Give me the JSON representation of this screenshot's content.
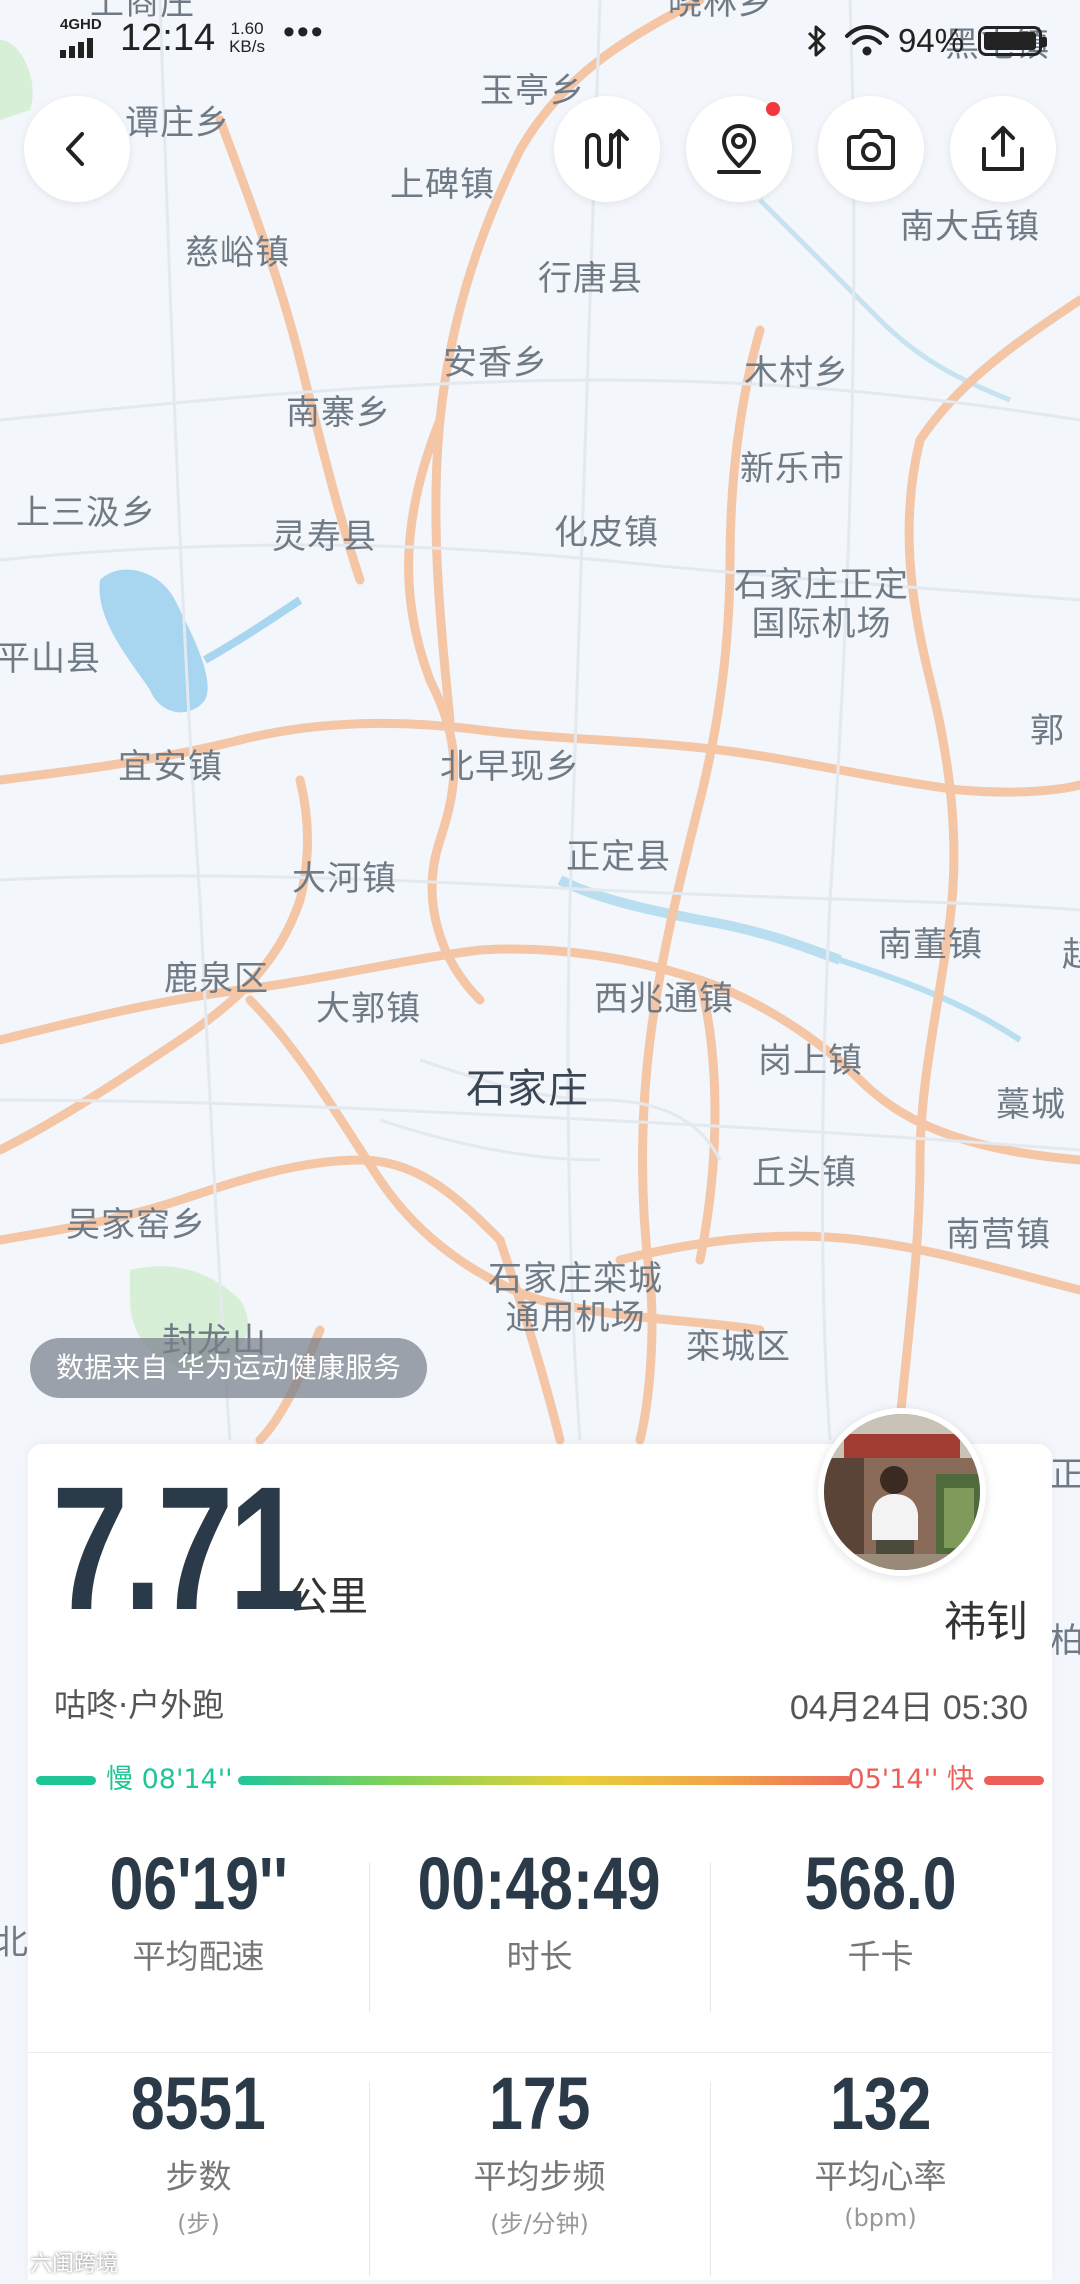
{
  "status_bar": {
    "network": "4GHD",
    "time": "12:14",
    "speed_value": "1.60",
    "speed_unit": "KB/s",
    "more": "•••",
    "battery": "94%"
  },
  "map": {
    "labels": [
      "上商庄",
      "晓林乡",
      "黑屯镇",
      "玉亭乡",
      "谭庄乡",
      "上碑镇",
      "南大岳镇",
      "慈峪镇",
      "行唐县",
      "安香乡",
      "木村乡",
      "南寨乡",
      "新乐市",
      "上三汲乡",
      "灵寿县",
      "化皮镇",
      "平山县",
      "郭",
      "宜安镇",
      "北早现乡",
      "正定县",
      "大河镇",
      "南董镇",
      "赵",
      "鹿泉区",
      "大郭镇",
      "西兆通镇",
      "岗上镇",
      "藁城",
      "丘头镇",
      "吴家窑乡",
      "南营镇",
      "栾城区",
      "封龙山",
      "正",
      "柏",
      "北"
    ],
    "airport_north": [
      "石家庄正定",
      "国际机场"
    ],
    "airport_south": [
      "石家庄栾城",
      "通用机场"
    ],
    "city": "石家庄"
  },
  "source": "数据来自 华为运动健康服务",
  "record": {
    "distance": "7.71",
    "distance_unit": "公里",
    "user_name": "祎钊",
    "activity": "咕咚·户外跑",
    "date_time": "04月24日 05:30",
    "pace_slow": "慢 08'14''",
    "pace_fast": "05'14'' 快",
    "stats": [
      {
        "value": "06'19''",
        "label": "平均配速",
        "unit": ""
      },
      {
        "value": "00:48:49",
        "label": "时长",
        "unit": ""
      },
      {
        "value": "568.0",
        "label": "千卡",
        "unit": ""
      },
      {
        "value": "8551",
        "label": "步数",
        "unit": "(步)"
      },
      {
        "value": "175",
        "label": "平均步频",
        "unit": "(步/分钟)"
      },
      {
        "value": "132",
        "label": "平均心率",
        "unit": "(bpm)"
      }
    ]
  },
  "watermark": "六闺跨境",
  "colors": {
    "slow": "#1ec596",
    "fast": "#ec5f59",
    "number": "#2b3a48",
    "road": "#f4c6a6",
    "water": "#9fd3ea",
    "notification": "#f2353f"
  }
}
